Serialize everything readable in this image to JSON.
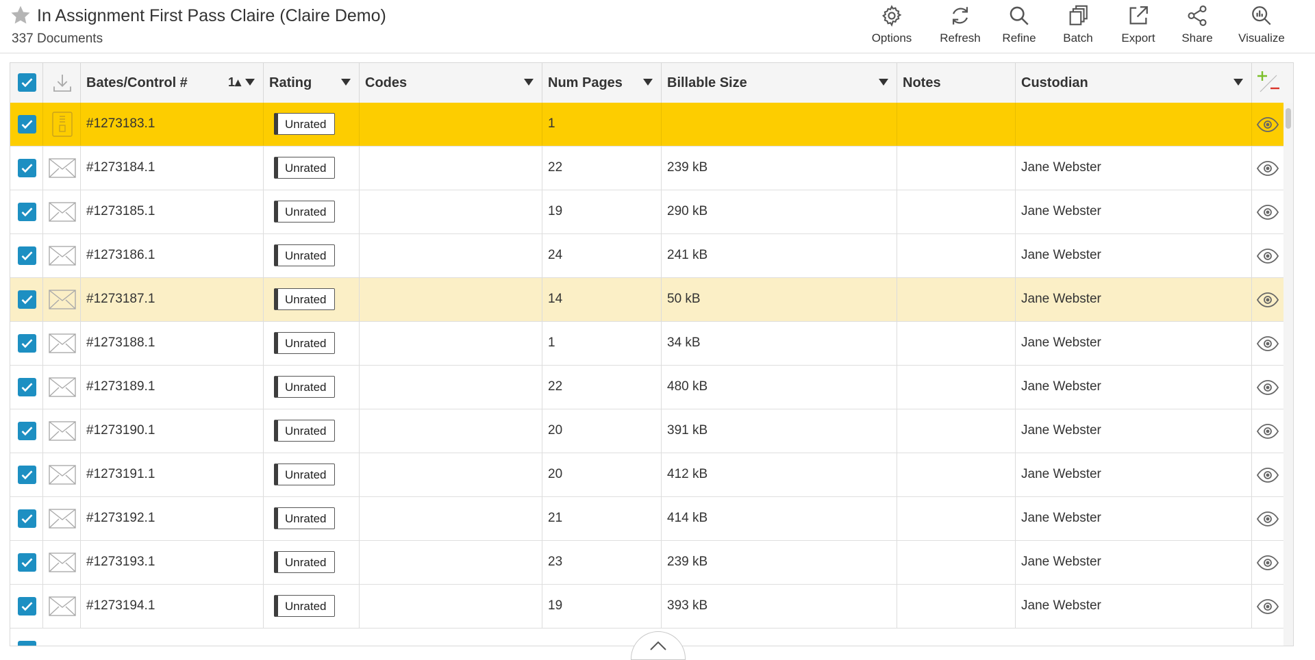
{
  "header": {
    "title": "In Assignment First Pass Claire (Claire Demo)",
    "doc_count": "337 Documents"
  },
  "toolbar": [
    {
      "id": "options",
      "label": "Options",
      "icon": "gear-icon"
    },
    {
      "id": "refresh",
      "label": "Refresh",
      "icon": "refresh-icon"
    },
    {
      "id": "refine",
      "label": "Refine",
      "icon": "search-icon"
    },
    {
      "id": "batch",
      "label": "Batch",
      "icon": "batch-icon"
    },
    {
      "id": "export",
      "label": "Export",
      "icon": "export-icon"
    },
    {
      "id": "share",
      "label": "Share",
      "icon": "share-icon"
    },
    {
      "id": "visualize",
      "label": "Visualize",
      "icon": "visualize-icon"
    }
  ],
  "columns": {
    "bates": "Bates/Control #",
    "bates_sort": "1▴",
    "rating": "Rating",
    "codes": "Codes",
    "num_pages": "Num Pages",
    "billable_size": "Billable Size",
    "notes": "Notes",
    "custodian": "Custodian"
  },
  "rows": [
    {
      "bates": "#1273183.1",
      "rating": "Unrated",
      "codes": "",
      "pages": "1",
      "size": "",
      "notes": "",
      "custodian": "",
      "type": "document",
      "state": "selected"
    },
    {
      "bates": "#1273184.1",
      "rating": "Unrated",
      "codes": "",
      "pages": "22",
      "size": "239 kB",
      "notes": "",
      "custodian": "Jane Webster",
      "type": "email",
      "state": ""
    },
    {
      "bates": "#1273185.1",
      "rating": "Unrated",
      "codes": "",
      "pages": "19",
      "size": "290 kB",
      "notes": "",
      "custodian": "Jane Webster",
      "type": "email",
      "state": ""
    },
    {
      "bates": "#1273186.1",
      "rating": "Unrated",
      "codes": "",
      "pages": "24",
      "size": "241 kB",
      "notes": "",
      "custodian": "Jane Webster",
      "type": "email",
      "state": ""
    },
    {
      "bates": "#1273187.1",
      "rating": "Unrated",
      "codes": "",
      "pages": "14",
      "size": "50 kB",
      "notes": "",
      "custodian": "Jane Webster",
      "type": "email",
      "state": "hover"
    },
    {
      "bates": "#1273188.1",
      "rating": "Unrated",
      "codes": "",
      "pages": "1",
      "size": "34 kB",
      "notes": "",
      "custodian": "Jane Webster",
      "type": "email",
      "state": ""
    },
    {
      "bates": "#1273189.1",
      "rating": "Unrated",
      "codes": "",
      "pages": "22",
      "size": "480 kB",
      "notes": "",
      "custodian": "Jane Webster",
      "type": "email",
      "state": ""
    },
    {
      "bates": "#1273190.1",
      "rating": "Unrated",
      "codes": "",
      "pages": "20",
      "size": "391 kB",
      "notes": "",
      "custodian": "Jane Webster",
      "type": "email",
      "state": ""
    },
    {
      "bates": "#1273191.1",
      "rating": "Unrated",
      "codes": "",
      "pages": "20",
      "size": "412 kB",
      "notes": "",
      "custodian": "Jane Webster",
      "type": "email",
      "state": ""
    },
    {
      "bates": "#1273192.1",
      "rating": "Unrated",
      "codes": "",
      "pages": "21",
      "size": "414 kB",
      "notes": "",
      "custodian": "Jane Webster",
      "type": "email",
      "state": ""
    },
    {
      "bates": "#1273193.1",
      "rating": "Unrated",
      "codes": "",
      "pages": "23",
      "size": "239 kB",
      "notes": "",
      "custodian": "Jane Webster",
      "type": "email",
      "state": ""
    },
    {
      "bates": "#1273194.1",
      "rating": "Unrated",
      "codes": "",
      "pages": "19",
      "size": "393 kB",
      "notes": "",
      "custodian": "Jane Webster",
      "type": "email",
      "state": ""
    }
  ],
  "colors": {
    "selected_row": "#fdcd00",
    "hover_row": "#fbefc6",
    "checkbox": "#1d8fc2",
    "add_green": "#7bbf2a",
    "remove_red": "#d9352b"
  }
}
